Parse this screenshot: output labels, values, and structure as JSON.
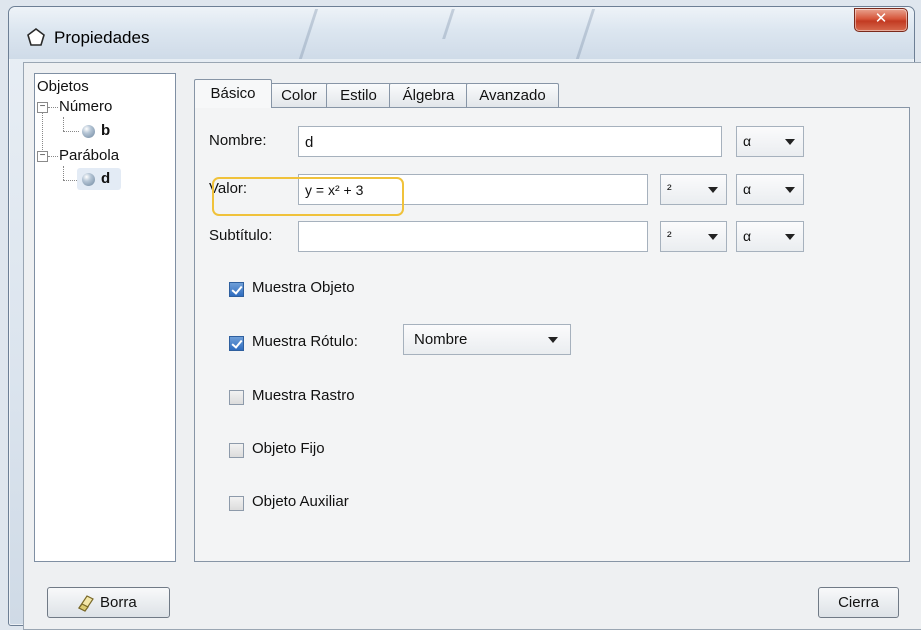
{
  "window": {
    "title": "Propiedades",
    "close_icon": "close-icon"
  },
  "tree": {
    "root": "Objetos",
    "groups": [
      {
        "label": "Número",
        "items": [
          "b"
        ]
      },
      {
        "label": "Parábola",
        "items": [
          "d"
        ]
      }
    ]
  },
  "tabs": [
    "Básico",
    "Color",
    "Estilo",
    "Álgebra",
    "Avanzado"
  ],
  "active_tab": "Básico",
  "form": {
    "name_label": "Nombre:",
    "name_value": "d",
    "value_label": "Valor:",
    "value_value": "y = x² + 3",
    "caption_label": "Subtítulo:",
    "caption_value": "",
    "symbol_dropdown": "²",
    "alpha_dropdown": "α"
  },
  "checkboxes": {
    "show_object": {
      "label": "Muestra Objeto",
      "checked": true
    },
    "show_label": {
      "label": "Muestra Rótulo:",
      "checked": true,
      "select_value": "Nombre"
    },
    "show_trace": {
      "label": "Muestra Rastro",
      "checked": false
    },
    "fix_object": {
      "label": "Objeto Fijo",
      "checked": false
    },
    "aux_object": {
      "label": "Objeto Auxiliar",
      "checked": false
    }
  },
  "buttons": {
    "delete": "Borra",
    "close": "Cierra"
  },
  "colors": {
    "highlight": "#f0c23b",
    "checkbox_checked": "#2f6cbf",
    "close_button": "#c23a22"
  }
}
